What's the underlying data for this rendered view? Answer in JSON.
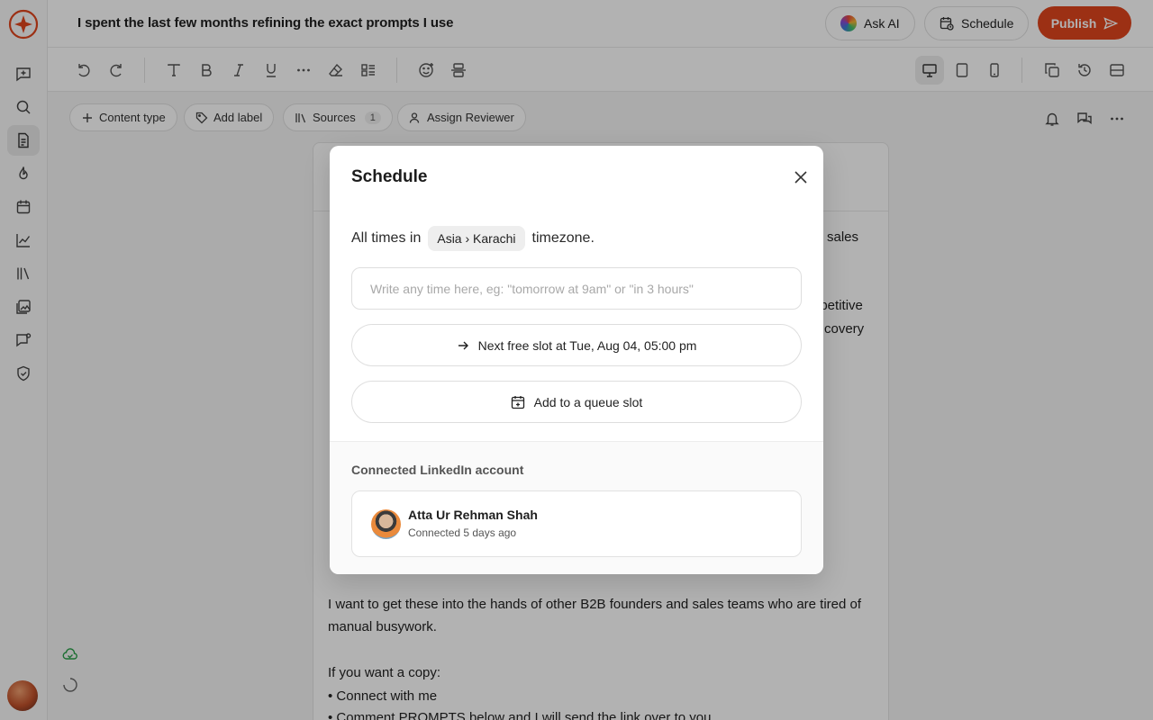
{
  "header": {
    "doc_title": "I spent the last few months refining the exact prompts I use",
    "ask_ai_label": "Ask AI",
    "schedule_label": "Schedule",
    "publish_label": "Publish"
  },
  "metabar": {
    "content_type_label": "Content type",
    "add_label_label": "Add label",
    "sources_label": "Sources",
    "sources_count": "1",
    "assign_reviewer_label": "Assign Reviewer"
  },
  "editor": {
    "frag_sales": "sales",
    "frag_epetitive": "epetitive",
    "frag_covery": "covery",
    "para1": "I want to get these into the hands of other B2B founders and sales teams who are tired of manual busywork.",
    "para2": "If you want a copy:",
    "bullet1": "• Connect with me",
    "bullet2": "• Comment PROMPTS below and I will send the link over to you"
  },
  "modal": {
    "title": "Schedule",
    "tz_prefix": "All times in",
    "tz_value": "Asia › Karachi",
    "tz_suffix": "timezone.",
    "input_placeholder": "Write any time here, eg: \"tomorrow at 9am\" or \"in 3 hours\"",
    "next_slot_label": "Next free slot at Tue, Aug 04, 05:00 pm",
    "queue_label": "Add to a queue slot",
    "connected_heading": "Connected LinkedIn account",
    "account_name": "Atta Ur Rehman Shah",
    "account_status": "Connected 5 days ago"
  },
  "colors": {
    "brand": "#e0451e",
    "save_indicator": "#2aa04a"
  }
}
